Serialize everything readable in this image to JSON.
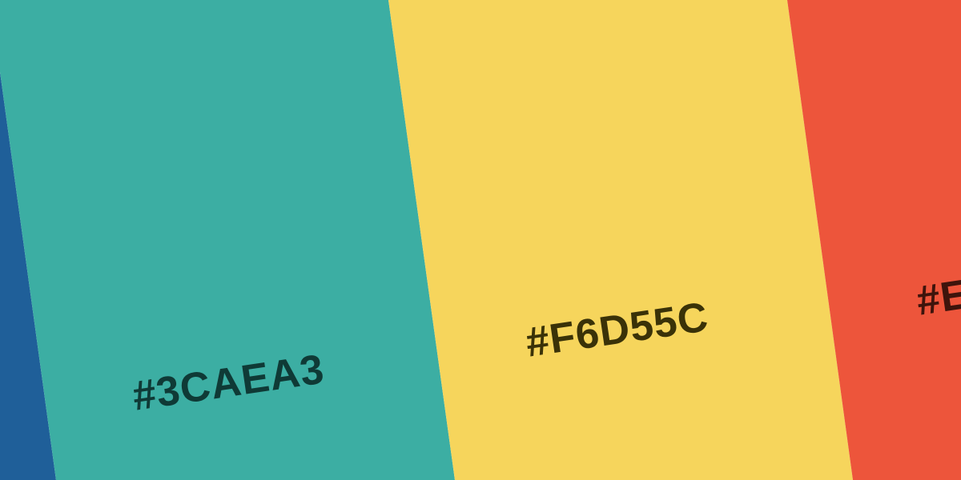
{
  "palette": {
    "swatches": [
      {
        "color": "#1F5F99",
        "label": ""
      },
      {
        "color": "#3CAEA3",
        "label": "#3CAEA3",
        "text_color": "#0F3A36"
      },
      {
        "color": "#F6D55C",
        "label": "#F6D55C",
        "text_color": "#3A3208"
      },
      {
        "color": "#ED553B",
        "label": "#E",
        "text_color": "#3E140C"
      }
    ]
  }
}
